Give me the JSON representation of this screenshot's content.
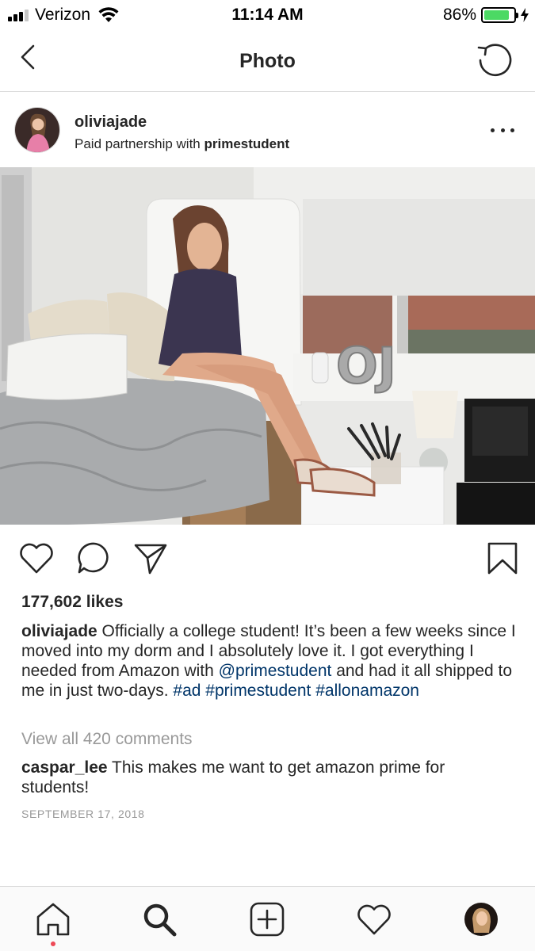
{
  "status_bar": {
    "carrier": "Verizon",
    "time": "11:14 AM",
    "battery_percent": "86%",
    "battery_level": 0.86,
    "battery_color": "#4cd964"
  },
  "nav": {
    "title": "Photo",
    "back_icon": "chevron-left-icon",
    "refresh_icon": "refresh-icon"
  },
  "post": {
    "username": "oliviajade",
    "partnership_prefix": "Paid partnership with",
    "partner": "primestudent",
    "photo_letters": "OJ"
  },
  "engagement": {
    "likes": "177,602 likes"
  },
  "caption": {
    "user": "oliviajade",
    "text_1": " Officially a college student! It’s been a few weeks since I moved into my dorm and I absolutely love it. I got everything I needed from Amazon with ",
    "mention": "@primestudent",
    "text_2": " and had it all shipped to me in just two-days. ",
    "hashtag_1": "#ad",
    "hashtag_2": "#primestudent",
    "hashtag_3": "#allonamazon",
    "link_color": "#003569"
  },
  "comments": {
    "view_all": "View all 420 comments",
    "top_comment_user": "caspar_lee",
    "top_comment_text": " This makes me want to get amazon prime for students!"
  },
  "post_date": "SEPTEMBER 17, 2018",
  "tabbar": {
    "items": [
      "home-icon",
      "search-icon",
      "add-post-icon",
      "activity-heart-icon",
      "profile-avatar"
    ],
    "notification_color": "#ed4956"
  }
}
